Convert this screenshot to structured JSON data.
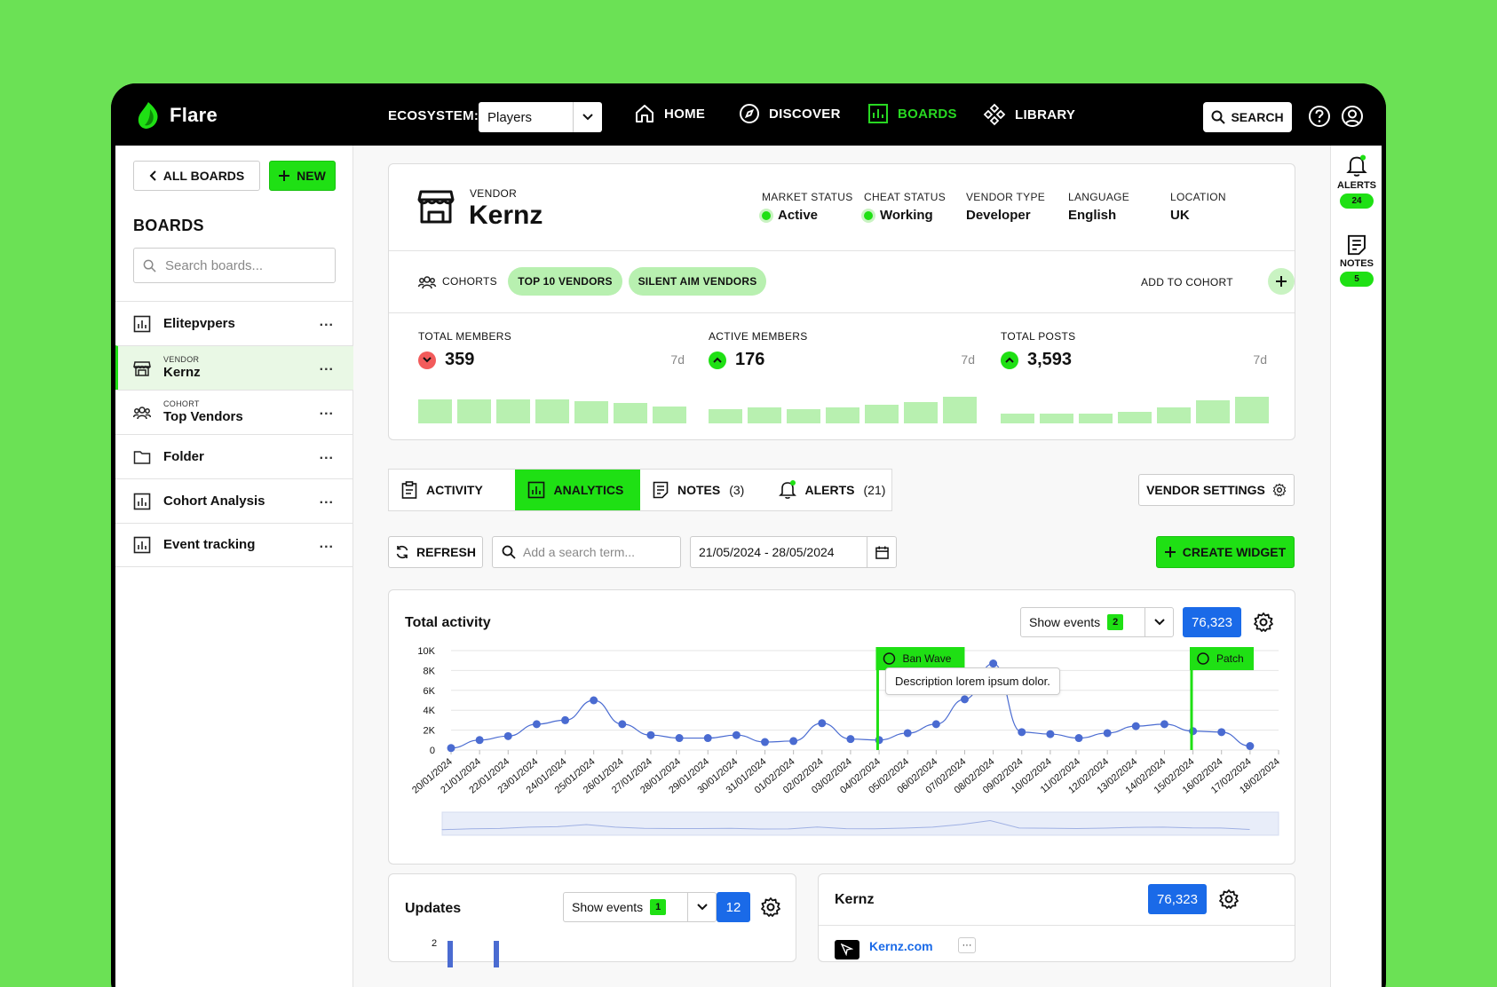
{
  "app": {
    "name": "Flare"
  },
  "topbar": {
    "ecosystem_label": "ECOSYSTEM:",
    "ecosystem_value": "Players",
    "nav": [
      {
        "label": "HOME",
        "icon": "home-icon"
      },
      {
        "label": "DISCOVER",
        "icon": "compass-icon"
      },
      {
        "label": "BOARDS",
        "icon": "chart-icon",
        "active": true
      },
      {
        "label": "LIBRARY",
        "icon": "library-icon"
      }
    ],
    "search_label": "SEARCH"
  },
  "sidebar": {
    "all_boards_label": "ALL BOARDS",
    "new_label": "NEW",
    "heading": "BOARDS",
    "search_placeholder": "Search boards...",
    "items": [
      {
        "label": "Elitepvpers",
        "sub": "",
        "icon": "chart-icon"
      },
      {
        "label": "Kernz",
        "sub": "VENDOR",
        "icon": "store-icon",
        "active": true
      },
      {
        "label": "Top Vendors",
        "sub": "COHORT",
        "icon": "users-icon"
      },
      {
        "label": "Folder",
        "sub": "",
        "icon": "folder-icon"
      },
      {
        "label": "Cohort Analysis",
        "sub": "",
        "icon": "chart-icon"
      },
      {
        "label": "Event tracking",
        "sub": "",
        "icon": "chart-icon"
      }
    ],
    "more_label": "..."
  },
  "rail": {
    "alerts_label": "ALERTS",
    "alerts_count": "24",
    "notes_label": "NOTES",
    "notes_count": "5"
  },
  "vendor": {
    "kind": "VENDOR",
    "name": "Kernz",
    "meta": [
      {
        "key": "MARKET STATUS",
        "value": "Active",
        "dot": true
      },
      {
        "key": "CHEAT STATUS",
        "value": "Working",
        "dot": true
      },
      {
        "key": "VENDOR TYPE",
        "value": "Developer"
      },
      {
        "key": "LANGUAGE",
        "value": "English"
      },
      {
        "key": "LOCATION",
        "value": "UK"
      }
    ],
    "cohorts_label": "COHORTS",
    "cohorts": [
      "TOP 10 VENDORS",
      "SILENT AIM VENDORS"
    ],
    "add_to_cohort": "ADD TO COHORT",
    "stats": [
      {
        "key": "TOTAL MEMBERS",
        "value": "359",
        "trend": "down",
        "period": "7d",
        "bars": [
          0.85,
          0.85,
          0.85,
          0.85,
          0.78,
          0.72,
          0.6
        ]
      },
      {
        "key": "ACTIVE MEMBERS",
        "value": "176",
        "trend": "up",
        "period": "7d",
        "bars": [
          0.5,
          0.55,
          0.5,
          0.55,
          0.65,
          0.75,
          0.95
        ]
      },
      {
        "key": "TOTAL POSTS",
        "value": "3,593",
        "trend": "up",
        "period": "7d",
        "bars": [
          0.35,
          0.35,
          0.35,
          0.42,
          0.55,
          0.8,
          0.95
        ]
      }
    ]
  },
  "tabs": [
    {
      "label": "ACTIVITY",
      "count": "",
      "icon": "clipboard-icon"
    },
    {
      "label": "ANALYTICS",
      "count": "",
      "icon": "chart-icon",
      "active": true
    },
    {
      "label": "NOTES",
      "count": "(3)",
      "icon": "notes-icon"
    },
    {
      "label": "ALERTS",
      "count": "(21)",
      "icon": "bell-icon"
    }
  ],
  "vendor_settings_label": "VENDOR SETTINGS",
  "toolbar": {
    "refresh_label": "REFRESH",
    "search_placeholder": "Add a search term...",
    "date_range": "21/05/2024 - 28/05/2024",
    "create_widget_label": "CREATE WIDGET"
  },
  "total_activity": {
    "title": "Total activity",
    "show_events_label": "Show events",
    "events_count": "2",
    "total": "76,323",
    "events": [
      {
        "label": "Ban Wave",
        "date_index": 15,
        "icon": "ban-icon"
      },
      {
        "label": "Patch",
        "date_index": 26,
        "icon": "patch-icon"
      }
    ],
    "tooltip": "Description lorem ipsum dolor."
  },
  "chart_data": {
    "type": "line",
    "x": [
      "20/01/2024",
      "21/01/2024",
      "22/01/2024",
      "23/01/2024",
      "24/01/2024",
      "25/01/2024",
      "26/01/2024",
      "27/01/2024",
      "28/01/2024",
      "29/01/2024",
      "30/01/2024",
      "31/01/2024",
      "01/02/2024",
      "02/02/2024",
      "03/02/2024",
      "04/02/2024",
      "05/02/2024",
      "06/02/2024",
      "07/02/2024",
      "08/02/2024",
      "09/02/2024",
      "10/02/2024",
      "11/02/2024",
      "12/02/2024",
      "13/02/2024",
      "14/02/2024",
      "15/02/2024",
      "16/02/2024",
      "17/02/2024",
      "18/02/2024"
    ],
    "series": [
      {
        "values": [
          200,
          1000,
          1400,
          2600,
          3000,
          5000,
          2600,
          1500,
          1200,
          1200,
          1500,
          800,
          900,
          2700,
          1100,
          1000,
          1700,
          2600,
          5100,
          8700,
          1800,
          1600,
          1200,
          1700,
          2400,
          2600,
          1900,
          1800,
          400
        ]
      }
    ],
    "yticks": [
      "0",
      "2K",
      "4K",
      "6K",
      "8K",
      "10K"
    ],
    "ylim": [
      0,
      10000
    ],
    "grid": true
  },
  "updates": {
    "title": "Updates",
    "show_events_label": "Show events",
    "events_count": "1",
    "total": "12",
    "ytick": "2"
  },
  "kernz_card": {
    "title": "Kernz",
    "total": "76,323",
    "link": "Kernz.com",
    "more": "···"
  }
}
